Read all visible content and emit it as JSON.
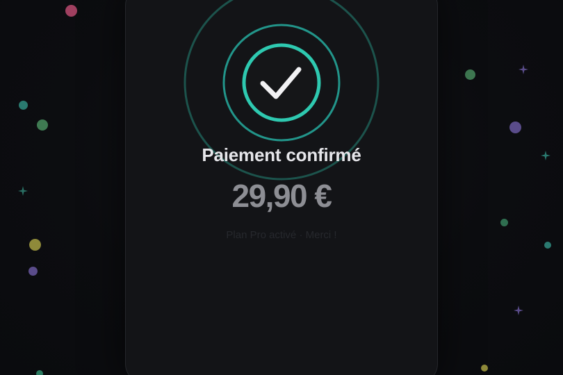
{
  "confirmation": {
    "title": "Paiement confirmé",
    "amount": "29,90 €",
    "subtitle": "Plan Pro activé · Merci !"
  },
  "icons": {
    "status": "checkmark-icon"
  },
  "colors": {
    "accent": "#2ec9b0",
    "background": "#0c0d10",
    "card": "#131417"
  }
}
